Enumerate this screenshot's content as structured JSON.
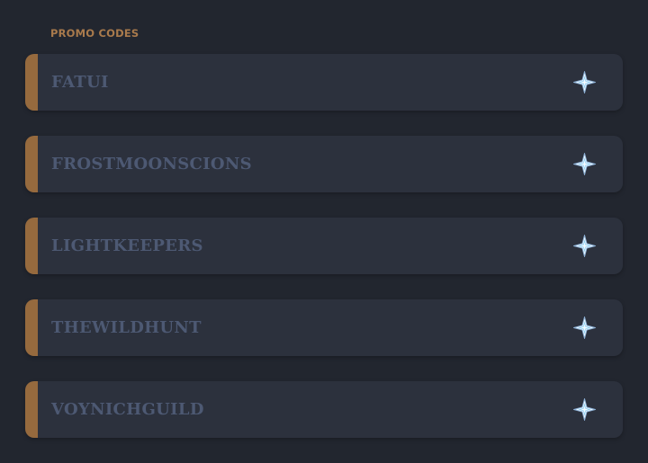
{
  "section": {
    "title": "PROMO CODES"
  },
  "codes": [
    {
      "code": "FATUI"
    },
    {
      "code": "FROSTMOONSCIONS"
    },
    {
      "code": "LIGHTKEEPERS"
    },
    {
      "code": "THEWILDHUNT"
    },
    {
      "code": "VOYNICHGUILD"
    }
  ],
  "icon": "primogem-icon",
  "colors": {
    "background": "#22262f",
    "card": "#2c313d",
    "accent": "#966a3e",
    "label": "#a97a4c",
    "code_text": "#4d5973"
  }
}
